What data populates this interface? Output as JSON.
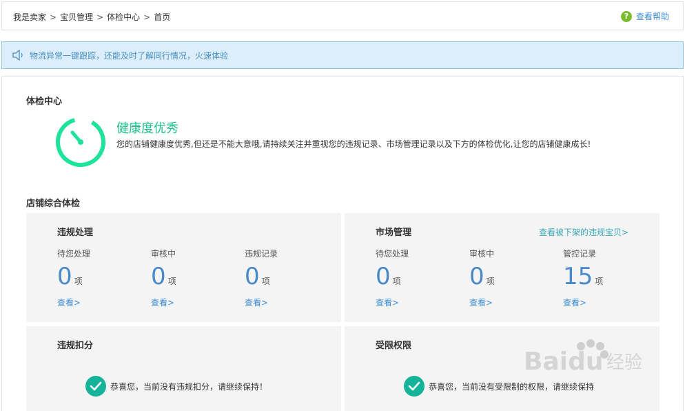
{
  "breadcrumb": {
    "items": [
      "我是卖家",
      "宝贝管理",
      "体检中心",
      "首页"
    ],
    "separator": ">"
  },
  "help": {
    "label": "查看帮助",
    "icon": "question-icon"
  },
  "notice": {
    "icon": "speaker-icon",
    "text": "物流异常一键跟踪，还能及时了解同行情况，火速体验"
  },
  "checkup": {
    "title": "体检中心",
    "gauge_icon": "stopwatch-icon",
    "health_title": "健康度优秀",
    "health_desc": "您的店铺健康度优秀,但还是不能大意哦,请持续关注并重视您的违规记录、市场管理记录以及下方的体检优化,让您的店铺健康成长!"
  },
  "overview": {
    "title": "店铺综合体检"
  },
  "violation": {
    "title": "违规处理",
    "stats": [
      {
        "label": "待您处理",
        "value": "0",
        "unit": "项",
        "link": "查看>"
      },
      {
        "label": "审核中",
        "value": "0",
        "unit": "项",
        "link": "查看>"
      },
      {
        "label": "违规记录",
        "value": "0",
        "unit": "项",
        "link": "查看>"
      }
    ]
  },
  "market": {
    "title": "市场管理",
    "link": "查看被下架的违规宝贝>",
    "stats": [
      {
        "label": "待您处理",
        "value": "0",
        "unit": "项",
        "link": "查看>"
      },
      {
        "label": "审核中",
        "value": "0",
        "unit": "项",
        "link": "查看>"
      },
      {
        "label": "管控记录",
        "value": "15",
        "unit": "项",
        "link": "查看>"
      }
    ]
  },
  "deduction": {
    "title": "违规扣分",
    "message": "恭喜您，当前没有违规扣分，请继续保持！",
    "icon": "check-icon"
  },
  "restriction": {
    "title": "受限权限",
    "message": "恭喜您，当前没有受限制的权限，请继续保持",
    "icon": "check-icon"
  },
  "watermark": {
    "brand": "Baidu",
    "text": "经验",
    "icon": "paw-icon"
  },
  "colors": {
    "accent_green": "#1ec08a",
    "link_blue": "#3d8fd6",
    "number_blue": "#4a89c8",
    "check_teal": "#15b39a"
  }
}
